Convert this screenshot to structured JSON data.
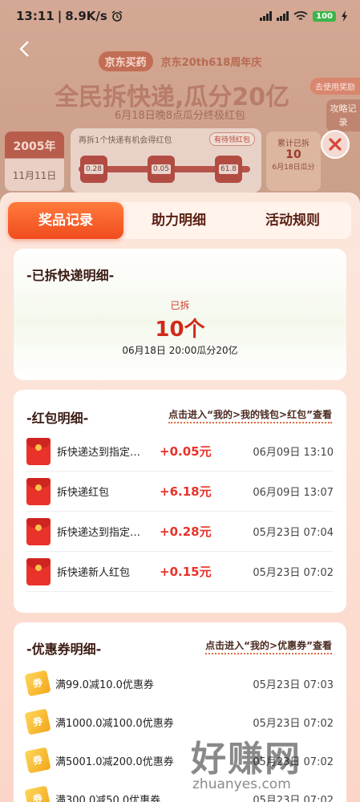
{
  "status_bar": {
    "time": "13:11",
    "speed": "8.9K/s",
    "battery": "100"
  },
  "background": {
    "brand": "京东买药",
    "anniversary": "京东20th618周年庆",
    "title": "全民拆快递,瓜分20亿",
    "subtitle": "6月18日晚8点瓜分终极红包",
    "used_reward": "去使用奖励",
    "guide": "攻略记录",
    "year_card": {
      "year": "2005年",
      "date": "11月11日"
    },
    "track_hint": "再拆1个快递有机会得红包",
    "pending_label": "有待领红包",
    "track_values": [
      "0.28",
      "0.05",
      "61.8"
    ],
    "total": {
      "line1": "累计已拆",
      "count": "10",
      "line3": "6月18日瓜分"
    }
  },
  "tabs": [
    {
      "label": "奖品记录",
      "active": true
    },
    {
      "label": "助力明细",
      "active": false
    },
    {
      "label": "活动规则",
      "active": false
    }
  ],
  "opened_section": {
    "title": "-已拆快递明细-",
    "label": "已拆",
    "count": "10个",
    "note": "06月18日 20:00瓜分20亿"
  },
  "red_packet_section": {
    "title": "-红包明细-",
    "link": "点击进入“我的>我的钱包>红包”查看",
    "items": [
      {
        "name": "拆快递达到指定数量红包",
        "amount": "+0.05元",
        "time": "06月09日 13:10"
      },
      {
        "name": "拆快递红包",
        "amount": "+6.18元",
        "time": "06月09日 13:07"
      },
      {
        "name": "拆快递达到指定数量红包",
        "amount": "+0.28元",
        "time": "05月23日 07:04"
      },
      {
        "name": "拆快递新人红包",
        "amount": "+0.15元",
        "time": "05月23日 07:02"
      }
    ]
  },
  "coupon_section": {
    "title": "-优惠券明细-",
    "link": "点击进入“我的>优惠券”查看",
    "items": [
      {
        "name": "满99.0减10.0优惠券",
        "time": "05月23日 07:03"
      },
      {
        "name": "满1000.0减100.0优惠券",
        "time": "05月23日 07:02"
      },
      {
        "name": "满5001.0减200.0优惠券",
        "time": "05月23日 07:02"
      },
      {
        "name": "满300.0减50.0优惠券",
        "time": "05月23日 07:02"
      }
    ]
  },
  "watermark": {
    "text": "好赚网",
    "url": "zhuanyes.com"
  },
  "colors": {
    "accent": "#f04c1d",
    "amount": "#e8322a",
    "sheet_bg": "#fde2d6"
  }
}
